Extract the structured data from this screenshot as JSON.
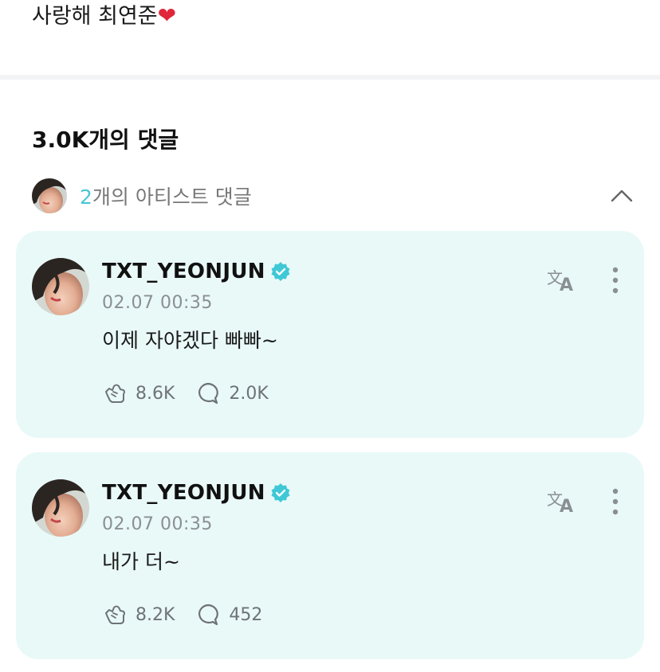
{
  "post": {
    "text": "사랑해 최연준",
    "emoji": "❤"
  },
  "comments_header": {
    "count_label": "3.0K개의 댓글"
  },
  "artist_comments": {
    "count": "2",
    "label": "개의 아티스트 댓글",
    "expanded": true
  },
  "comments": [
    {
      "author": "TXT_YEONJUN",
      "verified": true,
      "timestamp": "02.07 00:35",
      "text": "이제 자야겠다 빠빠~",
      "likes": "8.6K",
      "replies": "2.0K"
    },
    {
      "author": "TXT_YEONJUN",
      "verified": true,
      "timestamp": "02.07 00:35",
      "text": "내가 더~",
      "likes": "8.2K",
      "replies": "452"
    }
  ],
  "colors": {
    "card_bg": "#e9f9f8",
    "accent": "#49c6d6",
    "verified": "#3fc8d6",
    "muted": "#8a8f94"
  },
  "icons": {
    "collapse": "chevron-up-icon",
    "translate": "translate-icon",
    "more": "more-vertical-icon",
    "like": "like-icon",
    "reply": "reply-bubble-icon",
    "verified": "verified-badge-icon"
  }
}
